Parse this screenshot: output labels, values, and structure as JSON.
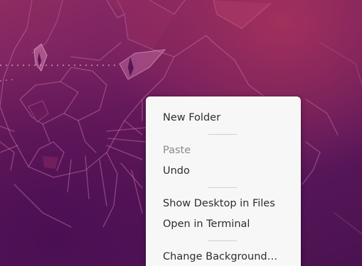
{
  "context_menu": {
    "items": [
      {
        "type": "item",
        "label": "New Folder",
        "enabled": true
      },
      {
        "type": "separator"
      },
      {
        "type": "item",
        "label": "Paste",
        "enabled": false
      },
      {
        "type": "item",
        "label": "Undo",
        "enabled": true
      },
      {
        "type": "separator"
      },
      {
        "type": "item",
        "label": "Show Desktop in Files",
        "enabled": true
      },
      {
        "type": "item",
        "label": "Open in Terminal",
        "enabled": true
      },
      {
        "type": "separator"
      },
      {
        "type": "item",
        "label": "Change Background…",
        "enabled": true
      }
    ]
  },
  "wallpaper": {
    "subject": "ubuntu-focal-fossa-line-art",
    "colors": {
      "primary": "#7a2362",
      "highlight": "#a1305c",
      "line": "#c46aa0"
    }
  }
}
